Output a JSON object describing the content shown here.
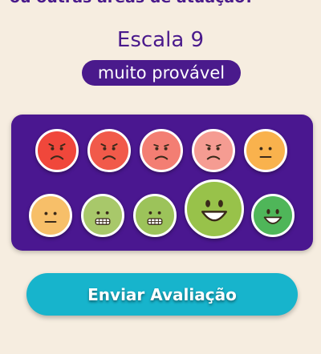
{
  "header": {
    "partial_text": "ou outras áreas de atuação?"
  },
  "scale": {
    "title": "Escala 9",
    "label": "muito provável"
  },
  "faces": [
    {
      "score": 1,
      "expression": "angry",
      "color": "#f0473b"
    },
    {
      "score": 2,
      "expression": "angry",
      "color": "#f15a4a"
    },
    {
      "score": 3,
      "expression": "sad",
      "color": "#f37e73"
    },
    {
      "score": 4,
      "expression": "sad",
      "color": "#f59c92"
    },
    {
      "score": 5,
      "expression": "neutral",
      "color": "#f9b24d"
    },
    {
      "score": 6,
      "expression": "neutral",
      "color": "#f7bf69"
    },
    {
      "score": 7,
      "expression": "grimace",
      "color": "#a8c86a"
    },
    {
      "score": 8,
      "expression": "grimace",
      "color": "#9cc35a"
    },
    {
      "score": 9,
      "expression": "happy",
      "color": "#98c24a",
      "selected": true
    },
    {
      "score": 10,
      "expression": "happy",
      "color": "#4fb659"
    }
  ],
  "submit": {
    "label": "Enviar Avaliação"
  }
}
